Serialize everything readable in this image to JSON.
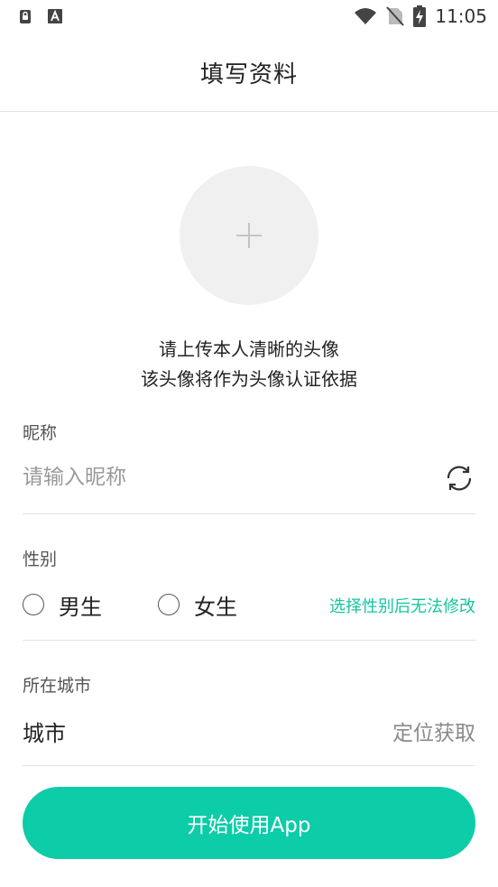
{
  "status_bar": {
    "time": "11:05",
    "icons": [
      "lock-badge-icon",
      "a-badge-icon",
      "wifi-icon",
      "no-sim-icon",
      "battery-charging-icon"
    ]
  },
  "header": {
    "title": "填写资料"
  },
  "avatar": {
    "icon": "plus-icon",
    "hint_line1": "请上传本人清晰的头像",
    "hint_line2": "该头像将作为头像认证依据"
  },
  "nickname": {
    "label": "昵称",
    "value": "",
    "placeholder": "请输入昵称",
    "refresh_icon": "refresh-icon"
  },
  "gender": {
    "label": "性别",
    "options": [
      {
        "label": "男生",
        "selected": false
      },
      {
        "label": "女生",
        "selected": false
      }
    ],
    "note": "选择性别后无法修改"
  },
  "city": {
    "label": "所在城市",
    "field_label": "城市",
    "action": "定位获取"
  },
  "submit": {
    "label": "开始使用App"
  },
  "colors": {
    "accent": "#0dcca8",
    "note_text": "#16c4a2",
    "divider": "#e3e3e3",
    "avatar_bg": "#f0f0f0"
  }
}
